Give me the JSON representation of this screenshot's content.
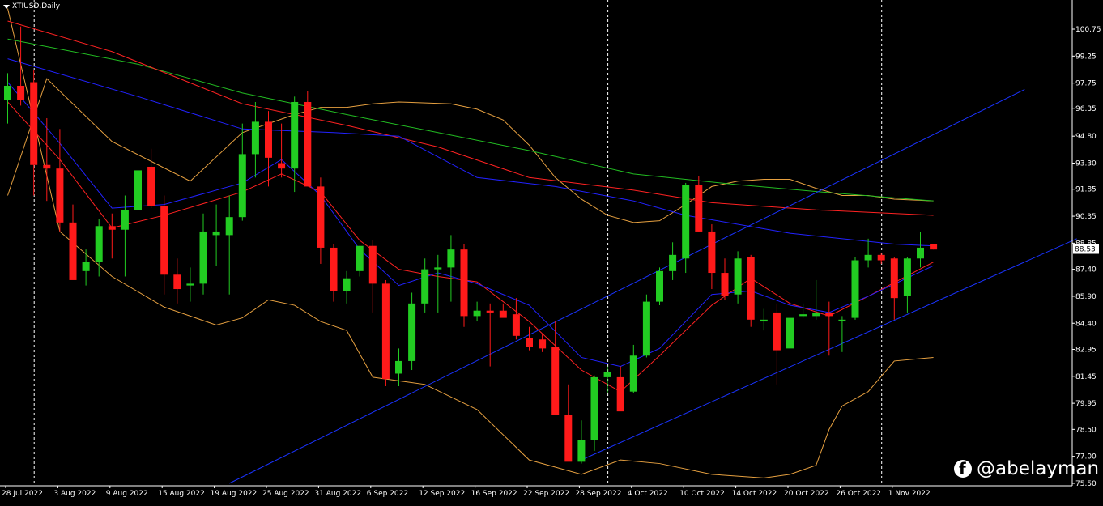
{
  "window": {
    "title": "XTIUSD,Daily",
    "watermark": "@abelayman"
  },
  "colors": {
    "background": "#000000",
    "bull": "#22cc22",
    "bear": "#ff1a1a",
    "ma_blue": "#2222ff",
    "ma_red": "#ff2222",
    "ma_green": "#22bb22",
    "bands": "#e6a040",
    "trendline": "#1a33ff",
    "grid": "#ffffff"
  },
  "chart_data": {
    "type": "candlestick",
    "symbol": "XTIUSD",
    "timeframe": "Daily",
    "y_ticks": [
      "100.75",
      "99.25",
      "97.75",
      "96.35",
      "94.80",
      "93.30",
      "91.85",
      "90.35",
      "88.85",
      "87.40",
      "85.90",
      "84.40",
      "82.95",
      "81.45",
      "79.95",
      "78.50",
      "77.00",
      "75.50"
    ],
    "ylim": [
      75.5,
      101.9
    ],
    "current_price": "88.53",
    "x_labels": [
      "28 Jul 2022",
      "3 Aug 2022",
      "9 Aug 2022",
      "15 Aug 2022",
      "19 Aug 2022",
      "25 Aug 2022",
      "31 Aug 2022",
      "6 Sep 2022",
      "12 Sep 2022",
      "16 Sep 2022",
      "22 Sep 2022",
      "28 Sep 2022",
      "4 Oct 2022",
      "10 Oct 2022",
      "14 Oct 2022",
      "20 Oct 2022",
      "26 Oct 2022",
      "1 Nov 2022"
    ],
    "month_separators": [
      "1 Aug 2022",
      "1 Sep 2022",
      "3 Oct 2022",
      "1 Nov 2022"
    ],
    "candles": [
      {
        "o": 96.8,
        "h": 98.3,
        "l": 95.5,
        "c": 97.6
      },
      {
        "o": 97.6,
        "h": 100.9,
        "l": 96.5,
        "c": 96.8
      },
      {
        "o": 97.8,
        "h": 98.5,
        "l": 91.5,
        "c": 93.2
      },
      {
        "o": 93.2,
        "h": 95.8,
        "l": 91.2,
        "c": 93.0
      },
      {
        "o": 93.0,
        "h": 95.2,
        "l": 89.5,
        "c": 90.0
      },
      {
        "o": 90.0,
        "h": 91.0,
        "l": 87.0,
        "c": 86.8
      },
      {
        "o": 87.3,
        "h": 88.5,
        "l": 86.5,
        "c": 87.8
      },
      {
        "o": 87.8,
        "h": 90.2,
        "l": 87.0,
        "c": 89.8
      },
      {
        "o": 89.8,
        "h": 90.5,
        "l": 88.0,
        "c": 89.6
      },
      {
        "o": 89.6,
        "h": 91.5,
        "l": 87.0,
        "c": 90.7
      },
      {
        "o": 90.7,
        "h": 93.5,
        "l": 90.5,
        "c": 92.9
      },
      {
        "o": 93.1,
        "h": 94.1,
        "l": 90.8,
        "c": 90.9
      },
      {
        "o": 90.9,
        "h": 91.5,
        "l": 86.0,
        "c": 87.1
      },
      {
        "o": 87.1,
        "h": 88.0,
        "l": 85.5,
        "c": 86.3
      },
      {
        "o": 86.5,
        "h": 87.5,
        "l": 85.6,
        "c": 86.6
      },
      {
        "o": 86.6,
        "h": 90.5,
        "l": 86.0,
        "c": 89.5
      },
      {
        "o": 89.3,
        "h": 91.0,
        "l": 87.6,
        "c": 89.5
      },
      {
        "o": 89.3,
        "h": 91.5,
        "l": 86.0,
        "c": 90.3
      },
      {
        "o": 90.3,
        "h": 95.5,
        "l": 90.1,
        "c": 93.8
      },
      {
        "o": 93.8,
        "h": 96.7,
        "l": 92.5,
        "c": 95.6
      },
      {
        "o": 95.6,
        "h": 96.2,
        "l": 92.0,
        "c": 93.6
      },
      {
        "o": 93.3,
        "h": 95.5,
        "l": 92.5,
        "c": 93.0
      },
      {
        "o": 93.0,
        "h": 97.0,
        "l": 91.7,
        "c": 96.7
      },
      {
        "o": 96.7,
        "h": 97.3,
        "l": 92.5,
        "c": 92.0
      },
      {
        "o": 92.0,
        "h": 92.5,
        "l": 87.7,
        "c": 88.6
      },
      {
        "o": 88.6,
        "h": 88.8,
        "l": 85.6,
        "c": 86.2
      },
      {
        "o": 86.2,
        "h": 87.3,
        "l": 85.5,
        "c": 86.9
      },
      {
        "o": 87.3,
        "h": 88.7,
        "l": 87.0,
        "c": 88.7
      },
      {
        "o": 88.7,
        "h": 89.0,
        "l": 85.0,
        "c": 86.6
      },
      {
        "o": 86.6,
        "h": 86.8,
        "l": 80.9,
        "c": 81.3
      },
      {
        "o": 81.6,
        "h": 83.0,
        "l": 80.9,
        "c": 82.3
      },
      {
        "o": 82.3,
        "h": 86.1,
        "l": 81.8,
        "c": 85.5
      },
      {
        "o": 85.5,
        "h": 88.0,
        "l": 85.0,
        "c": 87.4
      },
      {
        "o": 87.4,
        "h": 88.2,
        "l": 85.0,
        "c": 87.5
      },
      {
        "o": 87.5,
        "h": 89.3,
        "l": 85.6,
        "c": 88.5
      },
      {
        "o": 88.5,
        "h": 88.8,
        "l": 84.2,
        "c": 84.8
      },
      {
        "o": 84.8,
        "h": 85.6,
        "l": 84.5,
        "c": 85.1
      },
      {
        "o": 85.1,
        "h": 85.5,
        "l": 82.0,
        "c": 85.0
      },
      {
        "o": 85.1,
        "h": 85.5,
        "l": 84.8,
        "c": 84.7
      },
      {
        "o": 84.9,
        "h": 85.8,
        "l": 83.5,
        "c": 83.7
      },
      {
        "o": 83.6,
        "h": 84.2,
        "l": 82.9,
        "c": 83.1
      },
      {
        "o": 83.5,
        "h": 83.8,
        "l": 82.8,
        "c": 83.0
      },
      {
        "o": 83.1,
        "h": 84.5,
        "l": 79.5,
        "c": 79.3
      },
      {
        "o": 79.3,
        "h": 81.0,
        "l": 77.0,
        "c": 76.7
      },
      {
        "o": 76.7,
        "h": 79.0,
        "l": 76.6,
        "c": 77.9
      },
      {
        "o": 77.9,
        "h": 81.5,
        "l": 77.3,
        "c": 81.4
      },
      {
        "o": 81.4,
        "h": 82.0,
        "l": 80.5,
        "c": 81.7
      },
      {
        "o": 81.4,
        "h": 82.0,
        "l": 80.0,
        "c": 79.5
      },
      {
        "o": 80.6,
        "h": 83.2,
        "l": 80.5,
        "c": 82.6
      },
      {
        "o": 82.6,
        "h": 86.0,
        "l": 82.5,
        "c": 85.6
      },
      {
        "o": 85.6,
        "h": 87.5,
        "l": 85.4,
        "c": 87.3
      },
      {
        "o": 87.3,
        "h": 88.9,
        "l": 86.8,
        "c": 88.2
      },
      {
        "o": 88.0,
        "h": 92.2,
        "l": 87.2,
        "c": 92.1
      },
      {
        "o": 92.1,
        "h": 92.6,
        "l": 89.5,
        "c": 89.5
      },
      {
        "o": 89.5,
        "h": 89.9,
        "l": 86.3,
        "c": 87.2
      },
      {
        "o": 87.2,
        "h": 88.0,
        "l": 85.7,
        "c": 85.9
      },
      {
        "o": 86.0,
        "h": 88.4,
        "l": 85.5,
        "c": 88.0
      },
      {
        "o": 88.1,
        "h": 88.2,
        "l": 84.2,
        "c": 84.6
      },
      {
        "o": 84.5,
        "h": 85.2,
        "l": 84.0,
        "c": 84.6
      },
      {
        "o": 85.0,
        "h": 85.5,
        "l": 81.0,
        "c": 82.9
      },
      {
        "o": 83.0,
        "h": 85.3,
        "l": 81.8,
        "c": 84.7
      },
      {
        "o": 84.8,
        "h": 85.5,
        "l": 84.7,
        "c": 84.9
      },
      {
        "o": 84.8,
        "h": 86.8,
        "l": 84.6,
        "c": 85.0
      },
      {
        "o": 85.0,
        "h": 85.6,
        "l": 82.6,
        "c": 84.8
      },
      {
        "o": 84.6,
        "h": 84.8,
        "l": 82.8,
        "c": 84.6
      },
      {
        "o": 84.7,
        "h": 88.1,
        "l": 84.6,
        "c": 87.9
      },
      {
        "o": 87.9,
        "h": 89.1,
        "l": 87.5,
        "c": 88.2
      },
      {
        "o": 88.2,
        "h": 88.3,
        "l": 87.7,
        "c": 87.9
      },
      {
        "o": 88.0,
        "h": 88.1,
        "l": 84.6,
        "c": 85.8
      },
      {
        "o": 85.9,
        "h": 88.1,
        "l": 85.0,
        "c": 88.0
      },
      {
        "o": 88.0,
        "h": 89.5,
        "l": 87.5,
        "c": 88.6
      },
      {
        "o": 88.8,
        "h": 88.8,
        "l": 88.5,
        "c": 88.5
      }
    ],
    "indicators": {
      "ma_blue": [
        [
          0,
          99.1
        ],
        [
          10,
          97.0
        ],
        [
          18,
          95.2
        ],
        [
          25,
          95.0
        ],
        [
          30,
          94.8
        ],
        [
          36,
          92.5
        ],
        [
          42,
          92.0
        ],
        [
          48,
          91.2
        ],
        [
          52,
          90.4
        ],
        [
          60,
          89.4
        ],
        [
          68,
          88.8
        ],
        [
          71,
          88.7
        ]
      ],
      "ma_red": [
        [
          0,
          101.2
        ],
        [
          8,
          99.5
        ],
        [
          18,
          96.6
        ],
        [
          26,
          95.4
        ],
        [
          33,
          94.2
        ],
        [
          40,
          92.5
        ],
        [
          48,
          91.8
        ],
        [
          54,
          91.1
        ],
        [
          62,
          90.7
        ],
        [
          71,
          90.4
        ]
      ],
      "ma_green": [
        [
          0,
          100.2
        ],
        [
          10,
          98.8
        ],
        [
          18,
          97.2
        ],
        [
          26,
          96.0
        ],
        [
          33,
          95.0
        ],
        [
          40,
          94.0
        ],
        [
          48,
          92.7
        ],
        [
          56,
          92.1
        ],
        [
          64,
          91.6
        ],
        [
          71,
          91.2
        ]
      ],
      "ma_fast_blue": [
        [
          0,
          97.8
        ],
        [
          4,
          94.4
        ],
        [
          8,
          90.8
        ],
        [
          12,
          91.0
        ],
        [
          18,
          92.2
        ],
        [
          21,
          93.5
        ],
        [
          24,
          91.5
        ],
        [
          27,
          88.5
        ],
        [
          30,
          86.5
        ],
        [
          33,
          87.2
        ],
        [
          36,
          86.6
        ],
        [
          40,
          85.4
        ],
        [
          44,
          82.5
        ],
        [
          47,
          82.0
        ],
        [
          50,
          83.0
        ],
        [
          54,
          86.0
        ],
        [
          57,
          86.2
        ],
        [
          60,
          85.4
        ],
        [
          63,
          85.0
        ],
        [
          66,
          85.9
        ],
        [
          71,
          87.6
        ]
      ],
      "ma_fast_red": [
        [
          0,
          96.7
        ],
        [
          4,
          93.5
        ],
        [
          8,
          89.7
        ],
        [
          12,
          90.4
        ],
        [
          18,
          91.7
        ],
        [
          21,
          92.7
        ],
        [
          24,
          91.7
        ],
        [
          27,
          89.0
        ],
        [
          30,
          87.4
        ],
        [
          33,
          87.0
        ],
        [
          36,
          86.7
        ],
        [
          40,
          84.5
        ],
        [
          44,
          81.8
        ],
        [
          47,
          80.6
        ],
        [
          50,
          82.6
        ],
        [
          54,
          85.4
        ],
        [
          57,
          86.9
        ],
        [
          60,
          85.5
        ],
        [
          63,
          84.8
        ],
        [
          66,
          85.9
        ],
        [
          71,
          87.8
        ]
      ],
      "band_upper": [
        [
          0,
          91.5
        ],
        [
          3,
          98.0
        ],
        [
          8,
          94.5
        ],
        [
          14,
          92.3
        ],
        [
          18,
          95.0
        ],
        [
          22,
          96.0
        ],
        [
          24,
          96.4
        ],
        [
          26,
          96.4
        ],
        [
          28,
          96.6
        ],
        [
          30,
          96.7
        ],
        [
          34,
          96.6
        ],
        [
          36,
          96.3
        ],
        [
          38,
          95.7
        ],
        [
          40,
          94.3
        ],
        [
          42,
          92.5
        ],
        [
          44,
          91.3
        ],
        [
          46,
          90.4
        ],
        [
          48,
          90.0
        ],
        [
          50,
          90.1
        ],
        [
          52,
          91.0
        ],
        [
          54,
          92.0
        ],
        [
          56,
          92.3
        ],
        [
          58,
          92.4
        ],
        [
          60,
          92.4
        ],
        [
          62,
          91.9
        ],
        [
          64,
          91.5
        ],
        [
          66,
          91.5
        ],
        [
          68,
          91.3
        ],
        [
          71,
          91.2
        ]
      ],
      "band_lower": [
        [
          0,
          101.9
        ],
        [
          4,
          89.5
        ],
        [
          8,
          87.0
        ],
        [
          12,
          85.3
        ],
        [
          16,
          84.3
        ],
        [
          18,
          84.7
        ],
        [
          20,
          85.7
        ],
        [
          22,
          85.4
        ],
        [
          24,
          84.5
        ],
        [
          26,
          84.0
        ],
        [
          28,
          81.4
        ],
        [
          32,
          81.0
        ],
        [
          36,
          79.6
        ],
        [
          40,
          76.8
        ],
        [
          44,
          76.0
        ],
        [
          47,
          76.8
        ],
        [
          50,
          76.6
        ],
        [
          54,
          76.0
        ],
        [
          58,
          75.8
        ],
        [
          60,
          76.0
        ],
        [
          62,
          76.5
        ],
        [
          63,
          78.5
        ],
        [
          64,
          79.8
        ],
        [
          66,
          80.6
        ],
        [
          68,
          82.3
        ],
        [
          71,
          82.5
        ]
      ],
      "trend_lines": [
        {
          "from": [
            17,
            75.5
          ],
          "to": [
            78,
            97.4
          ]
        },
        {
          "from": [
            44,
            76.8
          ],
          "to": [
            82,
            89.1
          ]
        }
      ]
    }
  }
}
